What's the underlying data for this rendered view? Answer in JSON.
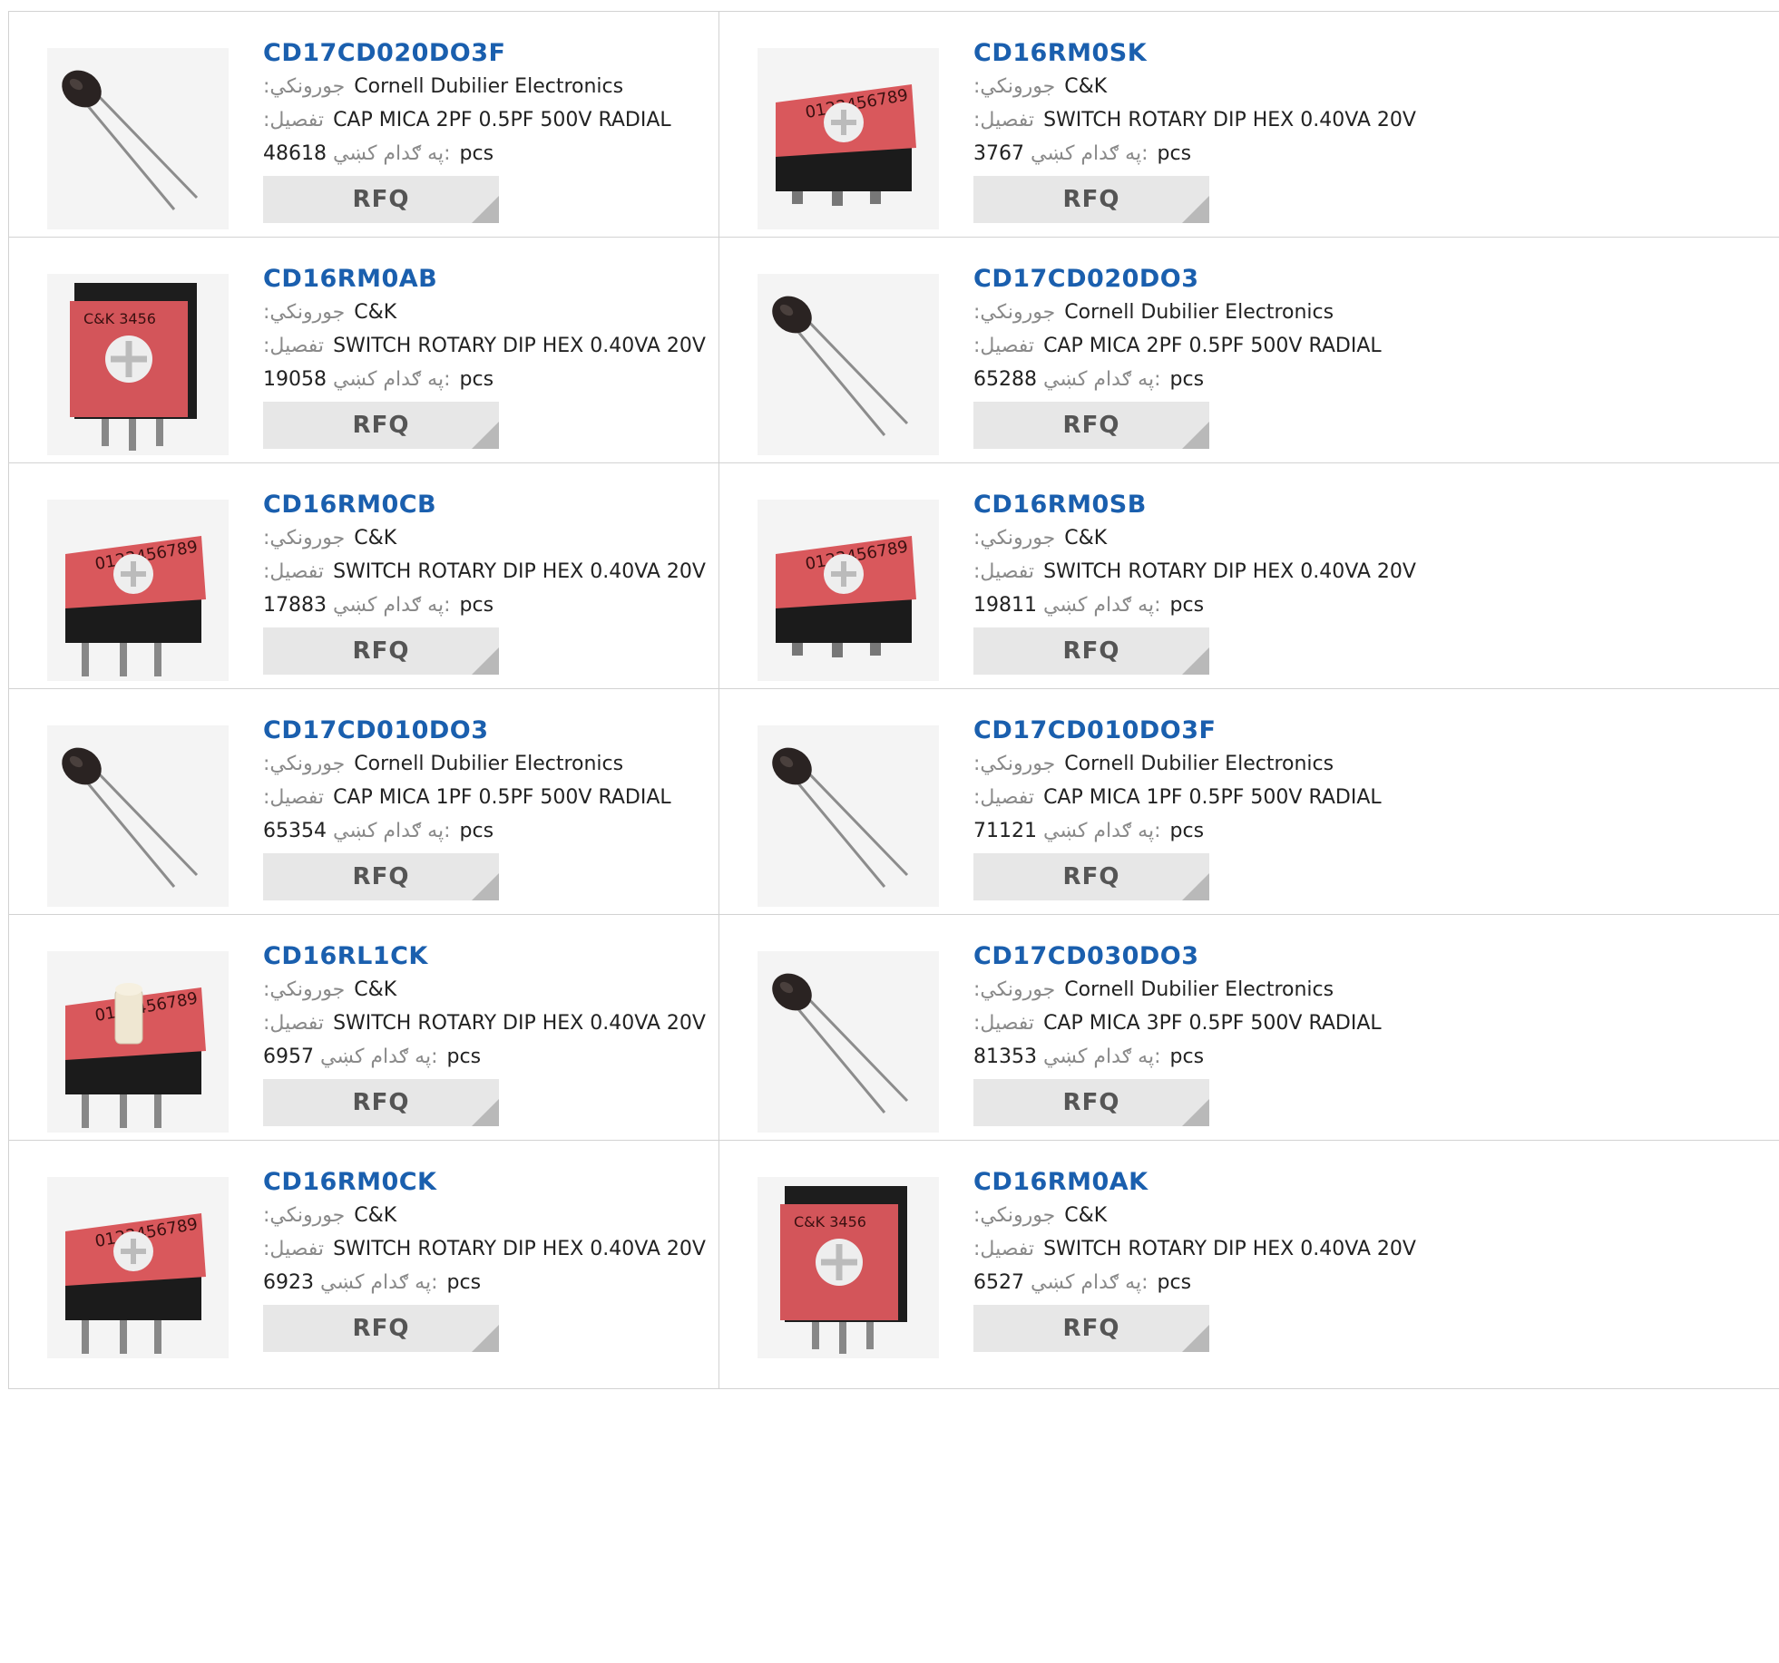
{
  "labels": {
    "manufacturer": ":جورونکي",
    "description": ":تفصيل",
    "stock": "په ګدام کښي:",
    "unit": "pcs",
    "rfq": "RFQ"
  },
  "products": [
    {
      "part": "CD17CD020DO3F",
      "manufacturer": "Cornell Dubilier Electronics",
      "description": "CAP MICA 2PF 0.5PF 500V RADIAL",
      "stock": "48618",
      "image": "capacitor-image"
    },
    {
      "part": "CD16RM0SK",
      "manufacturer": "C&K",
      "description": "SWITCH ROTARY DIP HEX 0.40VA 20V",
      "stock": "3767",
      "image": "rotary-switch-smd-image"
    },
    {
      "part": "CD16RM0AB",
      "manufacturer": "C&K",
      "description": "SWITCH ROTARY DIP HEX 0.40VA 20V",
      "stock": "19058",
      "image": "rotary-switch-vertical-image"
    },
    {
      "part": "CD17CD020DO3",
      "manufacturer": "Cornell Dubilier Electronics",
      "description": "CAP MICA 2PF 0.5PF 500V RADIAL",
      "stock": "65288",
      "image": "capacitor-image"
    },
    {
      "part": "CD16RM0CB",
      "manufacturer": "C&K",
      "description": "SWITCH ROTARY DIP HEX 0.40VA 20V",
      "stock": "17883",
      "image": "rotary-switch-image"
    },
    {
      "part": "CD16RM0SB",
      "manufacturer": "C&K",
      "description": "SWITCH ROTARY DIP HEX 0.40VA 20V",
      "stock": "19811",
      "image": "rotary-switch-smd-image"
    },
    {
      "part": "CD17CD010DO3",
      "manufacturer": "Cornell Dubilier Electronics",
      "description": "CAP MICA 1PF 0.5PF 500V RADIAL",
      "stock": "65354",
      "image": "capacitor-image"
    },
    {
      "part": "CD17CD010DO3F",
      "manufacturer": "Cornell Dubilier Electronics",
      "description": "CAP MICA 1PF 0.5PF 500V RADIAL",
      "stock": "71121",
      "image": "capacitor-image"
    },
    {
      "part": "CD16RL1CK",
      "manufacturer": "C&K",
      "description": "SWITCH ROTARY DIP HEX 0.40VA 20V",
      "stock": "6957",
      "image": "rotary-switch-knob-image"
    },
    {
      "part": "CD17CD030DO3",
      "manufacturer": "Cornell Dubilier Electronics",
      "description": "CAP MICA 3PF 0.5PF 500V RADIAL",
      "stock": "81353",
      "image": "capacitor-image"
    },
    {
      "part": "CD16RM0CK",
      "manufacturer": "C&K",
      "description": "SWITCH ROTARY DIP HEX 0.40VA 20V",
      "stock": "6923",
      "image": "rotary-switch-image"
    },
    {
      "part": "CD16RM0AK",
      "manufacturer": "C&K",
      "description": "SWITCH ROTARY DIP HEX 0.40VA 20V",
      "stock": "6527",
      "image": "rotary-switch-vertical-image"
    }
  ],
  "colors": {
    "title": "#1a5fae",
    "border": "#d2d2d2",
    "button": "#e7e7e7",
    "switch_body": "#d9585c"
  }
}
